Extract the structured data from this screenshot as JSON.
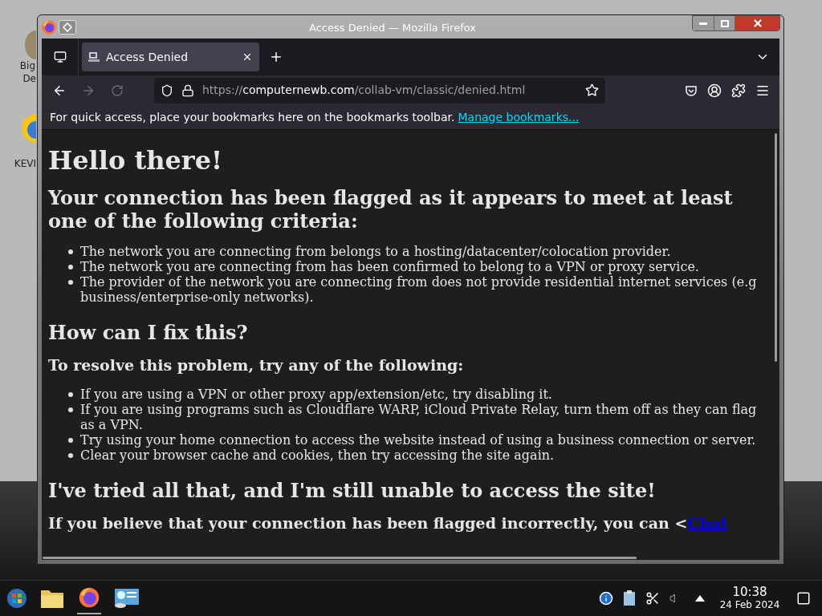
{
  "desktop": {
    "icons": [
      {
        "lines": [
          "Big",
          "De"
        ]
      },
      {
        "lines": [
          "KEVI"
        ]
      }
    ]
  },
  "window": {
    "title": "Access Denied — Mozilla Firefox"
  },
  "tabs": [
    {
      "title": "Access Denied",
      "selected": true
    }
  ],
  "address_bar": {
    "scheme": "https://",
    "host": "computernewb.com",
    "path": "/collab-vm/classic/denied.html"
  },
  "bookmarks_bar": {
    "message": "For quick access, place your bookmarks here on the bookmarks toolbar.",
    "link": "Manage bookmarks..."
  },
  "page": [
    {
      "kind": "h1",
      "text": "Hello there!"
    },
    {
      "kind": "h2",
      "text": "Your connection has been flagged as it appears to meet at least one of the following criteria:"
    },
    {
      "kind": "list",
      "items": [
        "The network you are connecting from belongs to a hosting/datacenter/colocation provider.",
        "The network you are connecting from has been confirmed to belong to a VPN or proxy service.",
        "The provider of the network you are connecting from does not provide residential internet services (e.g business/enterprise-only networks)."
      ]
    },
    {
      "kind": "h2",
      "text": "How can I fix this?"
    },
    {
      "kind": "h3",
      "text": "To resolve this problem, try any of the following:"
    },
    {
      "kind": "list",
      "items": [
        "If you are using a VPN or other proxy app/extension/etc, try disabling it.",
        "If you are using programs such as Cloudflare WARP, iCloud Private Relay, turn them off as they can flag as a VPN.",
        "Try using your home connection to access the website instead of using a business connection or server.",
        "Clear your browser cache and cookies, then try accessing the site again."
      ]
    },
    {
      "kind": "h2",
      "text": "I've tried all that, and I'm still unable to access the site!"
    },
    {
      "kind": "h3link",
      "text": "If you believe that your connection has been flagged incorrectly, you can <",
      "link": "Chat"
    }
  ],
  "taskbar": {
    "time": "10:38",
    "date": "24 Feb 2024"
  }
}
